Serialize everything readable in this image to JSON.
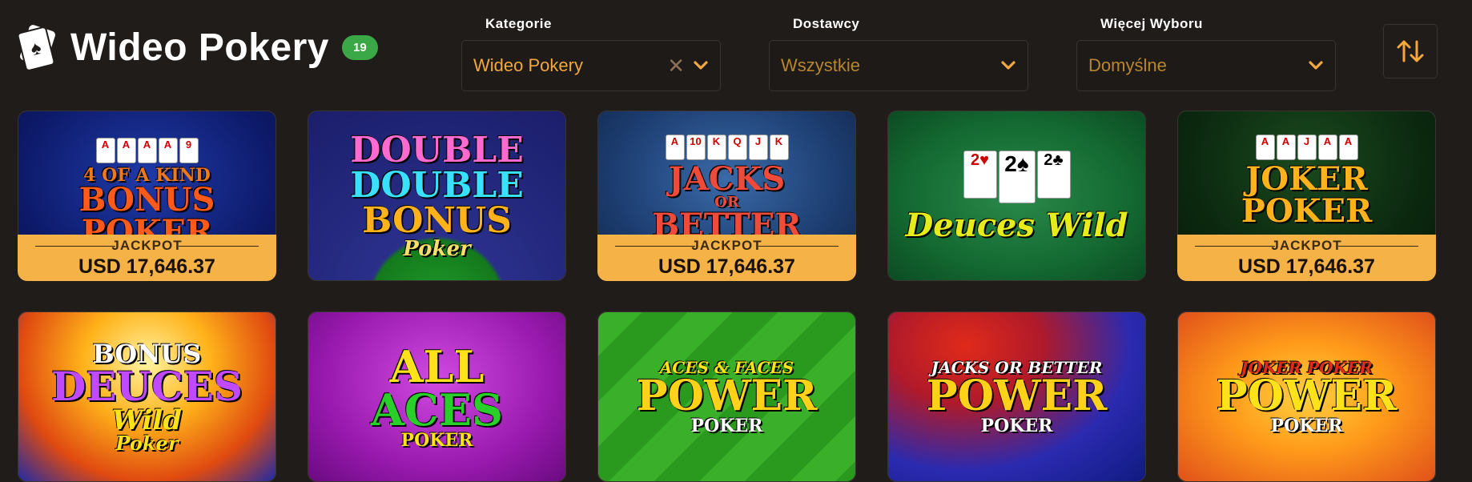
{
  "header": {
    "title": "Wideo Pokery",
    "count": "19"
  },
  "filters": {
    "category": {
      "label": "Kategorie",
      "value": "Wideo Pokery"
    },
    "provider": {
      "label": "Dostawcy",
      "value": "Wszystkie"
    },
    "more": {
      "label": "Więcej Wyboru",
      "value": "Domyślne"
    }
  },
  "jackpot_label": "JACKPOT",
  "games": [
    {
      "lines": [
        "4 OF A KIND",
        "BONUS",
        "POKER"
      ],
      "jackpot": "USD 17,646.37"
    },
    {
      "lines": [
        "DOUBLE",
        "DOUBLE",
        "BONUS",
        "Poker"
      ],
      "jackpot": ""
    },
    {
      "lines": [
        "JACKS",
        "OR",
        "BETTER"
      ],
      "jackpot": "USD 17,646.37"
    },
    {
      "lines": [
        "Deuces Wild"
      ],
      "jackpot": ""
    },
    {
      "lines": [
        "JOKER",
        "POKER"
      ],
      "jackpot": "USD 17,646.37"
    },
    {
      "lines": [
        "BONUS",
        "DEUCES",
        "Wild",
        "Poker"
      ],
      "jackpot": ""
    },
    {
      "lines": [
        "ALL",
        "ACES",
        "POKER"
      ],
      "jackpot": ""
    },
    {
      "lines": [
        "ACES & FACES",
        "POWER",
        "POKER"
      ],
      "jackpot": ""
    },
    {
      "lines": [
        "JACKS OR BETTER",
        "POWER",
        "POKER"
      ],
      "jackpot": ""
    },
    {
      "lines": [
        "JOKER POKER",
        "POWER",
        "POKER"
      ],
      "jackpot": ""
    }
  ]
}
